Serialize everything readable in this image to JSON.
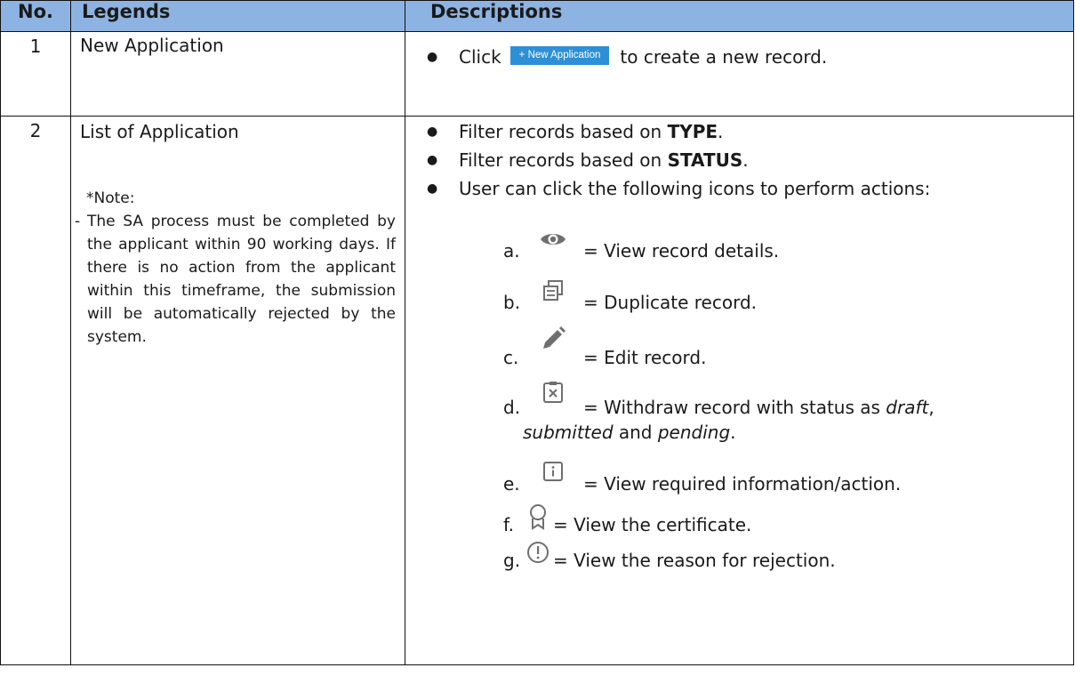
{
  "headers": {
    "no": "No.",
    "legends": "Legends",
    "descriptions": "Descriptions"
  },
  "row1": {
    "no": "1",
    "legend": "New Application",
    "desc_prefix": "Click",
    "button_label": "+ New Application",
    "desc_suffix": "to create a new record."
  },
  "row2": {
    "no": "2",
    "legend": "List of Application",
    "note_label": "*Note:",
    "note_dash": "-",
    "note_text": "The SA process must be completed by the applicant within 90 working days. If there is no action from the applicant within this timeframe, the submission will be automatically rejected by the system.",
    "filter_type_prefix": "Filter records based on ",
    "filter_type_bold": "TYPE",
    "filter_status_prefix": "Filter records based on ",
    "filter_status_bold": "STATUS",
    "actions_intro": "User can click the following icons to perform actions:",
    "items": [
      {
        "letter": "a.",
        "icon": "eye-icon",
        "text": "= View record details."
      },
      {
        "letter": "b.",
        "icon": "duplicate-icon",
        "text": "= Duplicate record."
      },
      {
        "letter": "c.",
        "icon": "pencil-icon",
        "text": "= Edit record."
      },
      {
        "letter": "d.",
        "icon": "withdraw-icon",
        "text": "= Withdraw record with status as",
        "em1": "draft",
        "comma": ",",
        "em2": "submitted",
        "and": " and ",
        "em3": "pending",
        "end": "."
      },
      {
        "letter": "e.",
        "icon": "info-icon",
        "text": "= View required information/action."
      },
      {
        "letter": "f.",
        "icon": "certificate-icon",
        "text": "= View the certificate."
      },
      {
        "letter": "g.",
        "icon": "alert-icon",
        "text": "= View the reason for rejection."
      }
    ]
  },
  "colors": {
    "header_bg": "#8db3e2",
    "button_bg": "#2d8fd5",
    "icon_gray": "#7a7a7a"
  }
}
